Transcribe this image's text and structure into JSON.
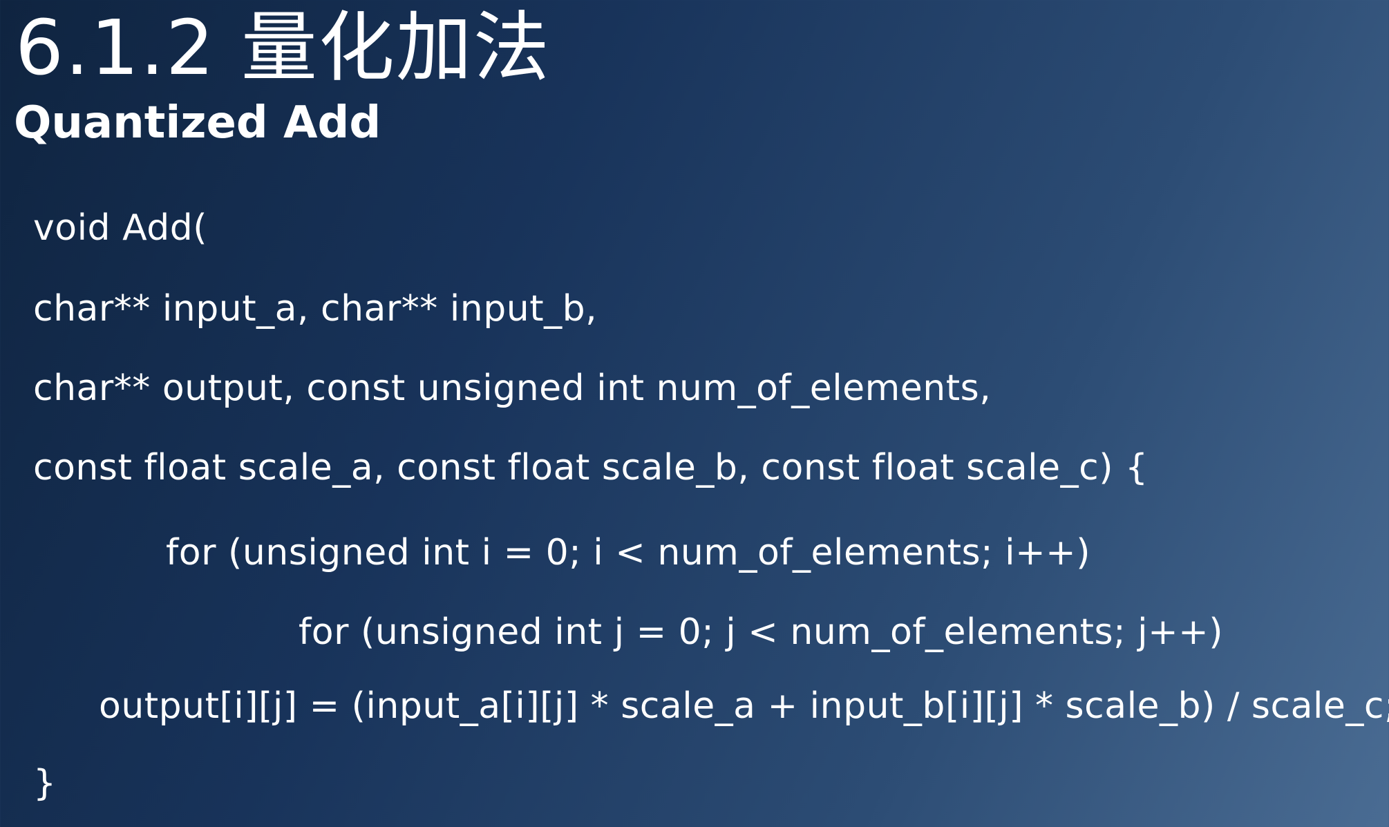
{
  "slide": {
    "title": "6.1.2 量化加法",
    "subtitle": "Quantized Add",
    "code_lines": [
      "void Add(",
      "char** input_a, char** input_b,",
      "char** output, const unsigned int num_of_elements,",
      "const float scale_a, const float scale_b, const float scale_c) {",
      "for (unsigned int i = 0; i < num_of_elements; i++)",
      "for (unsigned int j = 0; j < num_of_elements; j++)",
      "output[i][j] = (input_a[i][j] * scale_a + input_b[i][j] * scale_b) / scale_c;",
      "}"
    ]
  },
  "colors": {
    "background_start": "#0f2440",
    "background_end": "#4a6c93",
    "text": "#ffffff"
  }
}
